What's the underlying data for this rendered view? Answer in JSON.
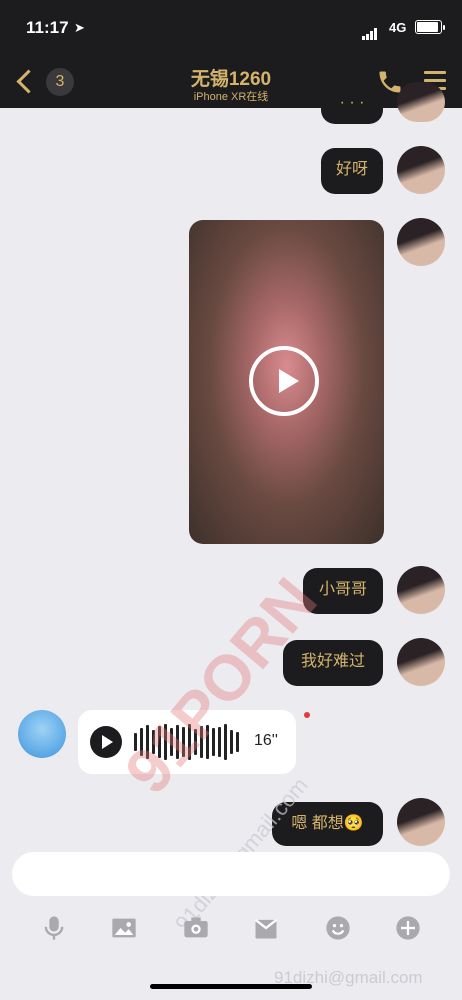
{
  "status": {
    "time": "11:17",
    "network": "4G"
  },
  "header": {
    "back_count": "3",
    "title": "无锡1260",
    "subtitle": "iPhone XR在线"
  },
  "messages": [
    {
      "type": "text",
      "text": "· · ·"
    },
    {
      "type": "text",
      "text": "好呀"
    },
    {
      "type": "video"
    },
    {
      "type": "text",
      "text": "小哥哥"
    },
    {
      "type": "text",
      "text": "我好难过"
    },
    {
      "type": "voice",
      "duration": "16''"
    },
    {
      "type": "text",
      "text": "嗯 都想🥺"
    }
  ],
  "watermark": {
    "main": "91PORN",
    "email_diag": "91dizhi@gmail.com",
    "email_bottom": "91dizhi@gmail.com"
  },
  "colors": {
    "accent": "#d4b36c",
    "dark": "#1c1c1e",
    "background": "#ebebf0"
  },
  "toolbar": [
    "microphone-icon",
    "image-icon",
    "camera-icon",
    "gift-box-icon",
    "emoji-icon",
    "plus-icon"
  ]
}
